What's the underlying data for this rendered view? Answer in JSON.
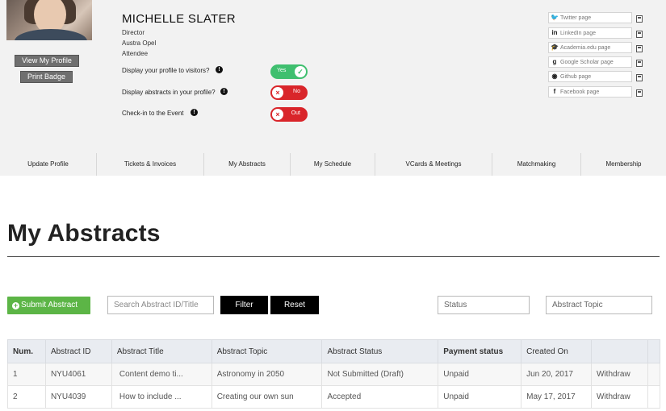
{
  "profile": {
    "name": "MICHELLE SLATER",
    "title": "Director",
    "company": "Austra Opel",
    "role": "Attendee",
    "view_profile_label": "View My Profile",
    "print_badge_label": "Print Badge",
    "settings": [
      {
        "label": "Display your profile to visitors?",
        "toggle_label": "Yes",
        "state": "on"
      },
      {
        "label": "Display abstracts in your profile?",
        "toggle_label": "No",
        "state": "off"
      },
      {
        "label": "Check-in to the Event",
        "toggle_label": "Out",
        "state": "off"
      }
    ],
    "social": [
      {
        "icon": "twitter-icon",
        "placeholder": "Twitter page"
      },
      {
        "icon": "linkedin-icon",
        "placeholder": "LinkedIn page"
      },
      {
        "icon": "academia-icon",
        "placeholder": "Academia.edu page"
      },
      {
        "icon": "google-scholar-icon",
        "placeholder": "Google Scholar page"
      },
      {
        "icon": "github-icon",
        "placeholder": "Github page"
      },
      {
        "icon": "facebook-icon",
        "placeholder": "Facebook page"
      }
    ]
  },
  "tabs": [
    "Update Profile",
    "Tickets & Invoices",
    "My Abstracts",
    "My Schedule",
    "VCards & Meetings",
    "Matchmaking",
    "Membership"
  ],
  "page_title": "My Abstracts",
  "toolbar": {
    "submit_label": "Submit Abstract",
    "search_placeholder": "Search Abstract ID/Title",
    "filter_label": "Filter",
    "reset_label": "Reset",
    "status_placeholder": "Status",
    "topic_placeholder": "Abstract Topic"
  },
  "table": {
    "headers": [
      "Num.",
      "Abstract ID",
      "Abstract Title",
      "Abstract Topic",
      "Abstract Status",
      "Payment status",
      "Created On",
      ""
    ],
    "rows": [
      {
        "num": "1",
        "id": "NYU4061",
        "title": "Content demo ti...",
        "topic": "Astronomy in 2050",
        "status": "Not Submitted (Draft)",
        "payment": "Unpaid",
        "created": "Jun 20, 2017",
        "action": "Withdraw"
      },
      {
        "num": "2",
        "id": "NYU4039",
        "title": "How to include ...",
        "topic": "Creating our own sun",
        "status": "Accepted",
        "payment": "Unpaid",
        "created": "May 17, 2017",
        "action": "Withdraw"
      }
    ]
  },
  "colors": {
    "accent_green": "#5cb546",
    "toggle_on": "#3fbf6f",
    "toggle_off": "#d9252a",
    "accepted": "#4a9f2e"
  }
}
